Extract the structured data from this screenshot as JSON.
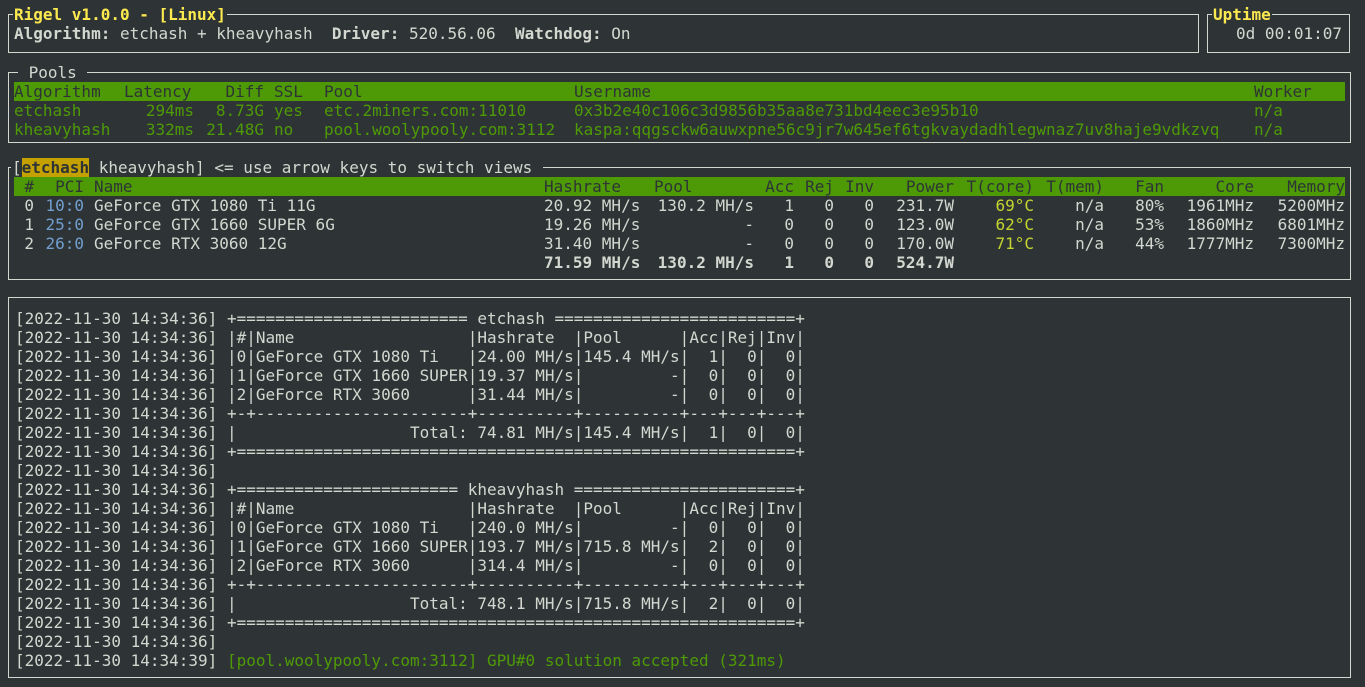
{
  "header": {
    "app_title": "Rigel v1.0.0 - [Linux]",
    "algorithm_label": "Algorithm:",
    "algorithm_value": "etchash + kheavyhash",
    "driver_label": "Driver:",
    "driver_value": "520.56.06",
    "watchdog_label": "Watchdog:",
    "watchdog_value": "On"
  },
  "uptime": {
    "label": "Uptime",
    "value": "0d 00:01:07"
  },
  "pools": {
    "title": "Pools",
    "columns": [
      "Algorithm",
      "Latency",
      "Diff",
      "SSL",
      "Pool",
      "Username",
      "Worker"
    ],
    "rows": [
      {
        "algorithm": "etchash",
        "latency": "294ms",
        "diff": "8.73G",
        "ssl": "yes",
        "pool": "etc.2miners.com:11010",
        "username": "0x3b2e40c106c3d9856b35aa8e731bd4eec3e95b10",
        "worker": "n/a"
      },
      {
        "algorithm": "kheavyhash",
        "latency": "332ms",
        "diff": "21.48G",
        "ssl": "no",
        "pool": "pool.woolypooly.com:3112",
        "username": "kaspa:qqgsckw6auwxpne56c9jr7w645ef6tgkvaydadhlegwnaz7uv8haje9vdkzvq",
        "worker": "n/a"
      }
    ]
  },
  "views": {
    "open": "[",
    "tab_active": "etchash",
    "tab_other": "kheavyhash",
    "close": "]",
    "hint": "<= use arrow keys to switch views"
  },
  "gpus": {
    "columns": [
      "#",
      "PCI",
      "Name",
      "Hashrate",
      "Pool",
      "Acc",
      "Rej",
      "Inv",
      "Power",
      "T(core)",
      "T(mem)",
      "Fan",
      "Core",
      "Memory"
    ],
    "rows": [
      {
        "idx": "0",
        "pci": "10:0",
        "name": "GeForce GTX 1080 Ti 11G",
        "hashrate": "20.92 MH/s",
        "pool": "130.2 MH/s",
        "acc": "1",
        "rej": "0",
        "inv": "0",
        "power": "231.7W",
        "tcore": "69°C",
        "tmem": "n/a",
        "fan": "80%",
        "core": "1961MHz",
        "memory": "5200MHz"
      },
      {
        "idx": "1",
        "pci": "25:0",
        "name": "GeForce GTX 1660 SUPER 6G",
        "hashrate": "19.26 MH/s",
        "pool": "-",
        "acc": "0",
        "rej": "0",
        "inv": "0",
        "power": "123.0W",
        "tcore": "62°C",
        "tmem": "n/a",
        "fan": "53%",
        "core": "1860MHz",
        "memory": "6801MHz"
      },
      {
        "idx": "2",
        "pci": "26:0",
        "name": "GeForce RTX 3060 12G",
        "hashrate": "31.40 MH/s",
        "pool": "-",
        "acc": "0",
        "rej": "0",
        "inv": "0",
        "power": "170.0W",
        "tcore": "71°C",
        "tmem": "n/a",
        "fan": "44%",
        "core": "1777MHz",
        "memory": "7300MHz"
      }
    ],
    "total": {
      "hashrate": "71.59 MH/s",
      "pool": "130.2 MH/s",
      "acc": "1",
      "rej": "0",
      "inv": "0",
      "power": "524.7W"
    }
  },
  "log": {
    "lines": [
      {
        "ts": "[2022-11-30 14:34:36]",
        "text": "+======================== etchash =========================+"
      },
      {
        "ts": "[2022-11-30 14:34:36]",
        "text": "|#|Name                  |Hashrate  |Pool      |Acc|Rej|Inv|"
      },
      {
        "ts": "[2022-11-30 14:34:36]",
        "text": "|0|GeForce GTX 1080 Ti   |24.00 MH/s|145.4 MH/s|  1|  0|  0|"
      },
      {
        "ts": "[2022-11-30 14:34:36]",
        "text": "|1|GeForce GTX 1660 SUPER|19.37 MH/s|         -|  0|  0|  0|"
      },
      {
        "ts": "[2022-11-30 14:34:36]",
        "text": "|2|GeForce RTX 3060      |31.44 MH/s|         -|  0|  0|  0|"
      },
      {
        "ts": "[2022-11-30 14:34:36]",
        "text": "+-+----------------------+----------+----------+---+---+---+"
      },
      {
        "ts": "[2022-11-30 14:34:36]",
        "text": "|                  Total: 74.81 MH/s|145.4 MH/s|  1|  0|  0|"
      },
      {
        "ts": "[2022-11-30 14:34:36]",
        "text": "+==========================================================+"
      },
      {
        "ts": "[2022-11-30 14:34:36]",
        "text": ""
      },
      {
        "ts": "[2022-11-30 14:34:36]",
        "text": "+======================= kheavyhash =======================+"
      },
      {
        "ts": "[2022-11-30 14:34:36]",
        "text": "|#|Name                  |Hashrate  |Pool      |Acc|Rej|Inv|"
      },
      {
        "ts": "[2022-11-30 14:34:36]",
        "text": "|0|GeForce GTX 1080 Ti   |240.0 MH/s|         -|  0|  0|  0|"
      },
      {
        "ts": "[2022-11-30 14:34:36]",
        "text": "|1|GeForce GTX 1660 SUPER|193.7 MH/s|715.8 MH/s|  2|  0|  0|"
      },
      {
        "ts": "[2022-11-30 14:34:36]",
        "text": "|2|GeForce RTX 3060      |314.4 MH/s|         -|  0|  0|  0|"
      },
      {
        "ts": "[2022-11-30 14:34:36]",
        "text": "+-+----------------------+----------+----------+---+---+---+"
      },
      {
        "ts": "[2022-11-30 14:34:36]",
        "text": "|                  Total: 748.1 MH/s|715.8 MH/s|  2|  0|  0|"
      },
      {
        "ts": "[2022-11-30 14:34:36]",
        "text": "+==========================================================+"
      },
      {
        "ts": "[2022-11-30 14:34:36]",
        "text": ""
      }
    ],
    "accepted": {
      "ts": "[2022-11-30 14:34:39]",
      "text": "[pool.woolypooly.com:3112] GPU#0 solution accepted (321ms)"
    }
  },
  "colors": {
    "background": "#2e3436",
    "header_bar": "#4e9a06",
    "title_yellow": "#fce94f",
    "selected_tab": "#c4a000",
    "pci_blue": "#729fcf",
    "temp_yellowgreen": "#c4d52f"
  }
}
